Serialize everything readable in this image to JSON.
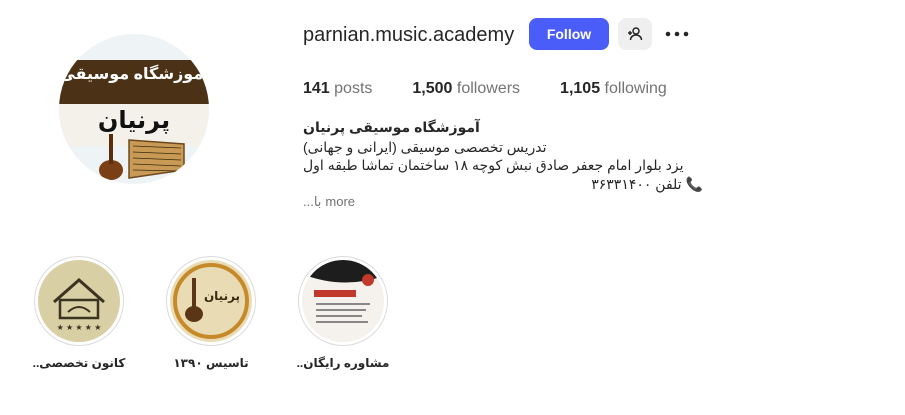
{
  "profile": {
    "avatar_line1": "آموزشگاه موسیقی",
    "avatar_line2": "پرنیان",
    "username": "parnian.music.academy",
    "follow_label": "Follow",
    "stats": {
      "posts_count": "141",
      "posts_label": "posts",
      "followers_count": "1,500",
      "followers_label": "followers",
      "following_count": "1,105",
      "following_label": "following"
    },
    "bio": {
      "name": "آموزشگاه موسیقی پرنیان",
      "line1": "تدریس تخصصی موسیقی (ایرانی و جهانی)",
      "line2": "یزد بلوار امام جعفر صادق نبش کوچه ۱۸ ساختمان تماشا طبقه اول",
      "line3": "تلفن ۳۶۳۳۱۴۰۰",
      "truncated": "با...",
      "more_label": "more"
    }
  },
  "highlights": [
    {
      "label": "کانون تخصصی..",
      "icon": "house-logo-icon"
    },
    {
      "label": "تاسیس ۱۳۹۰",
      "icon": "santur-logo-icon"
    },
    {
      "label": "مشاوره رایگان..",
      "icon": "flyer-icon"
    }
  ],
  "colors": {
    "follow_button": "#4a5df9",
    "secondary_button": "#efefef",
    "muted_text": "#737373",
    "phone_icon": "#e0245e"
  }
}
